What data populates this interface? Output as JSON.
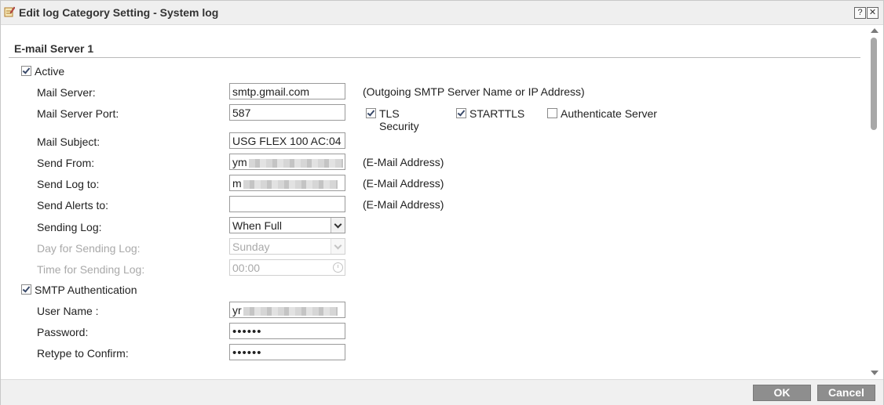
{
  "window": {
    "title": "Edit log Category Setting - System log",
    "title_icon": "edit-note-icon",
    "help_glyph": "?",
    "close_glyph": "✕"
  },
  "section": {
    "title": "E-mail Server 1"
  },
  "form": {
    "active": {
      "label": "Active",
      "checked": true
    },
    "mail_server": {
      "label": "Mail Server:",
      "value": "smtp.gmail.com",
      "hint": "(Outgoing SMTP Server Name or IP Address)"
    },
    "mail_server_port": {
      "label": "Mail Server Port:",
      "value": "587",
      "tls_label_line1": "TLS",
      "tls_label_line2": "Security",
      "tls_checked": true,
      "starttls_label": "STARTTLS",
      "starttls_checked": true,
      "auth_server_label": "Authenticate Server",
      "auth_server_checked": false
    },
    "mail_subject": {
      "label": "Mail Subject:",
      "value": "USG FLEX 100 AC:04"
    },
    "send_from": {
      "label": "Send From:",
      "value_prefix": "ym",
      "hint": "(E-Mail Address)"
    },
    "send_log_to": {
      "label": "Send Log to:",
      "value_prefix": "m",
      "hint": "(E-Mail Address)"
    },
    "send_alerts_to": {
      "label": "Send Alerts to:",
      "value": "",
      "hint": "(E-Mail Address)"
    },
    "sending_log": {
      "label": "Sending Log:",
      "value": "When Full"
    },
    "day_for_sending_log": {
      "label": "Day for Sending Log:",
      "value": "Sunday"
    },
    "time_for_sending_log": {
      "label": "Time for Sending Log:",
      "value": "00:00"
    },
    "smtp_authentication": {
      "label": "SMTP Authentication",
      "checked": true
    },
    "user_name": {
      "label": "User Name :",
      "value_prefix": "yr"
    },
    "password": {
      "label": "Password:",
      "value": "••••••"
    },
    "retype": {
      "label": "Retype to Confirm:",
      "value": "••••••"
    }
  },
  "footer": {
    "ok_label": "OK",
    "cancel_label": "Cancel"
  }
}
